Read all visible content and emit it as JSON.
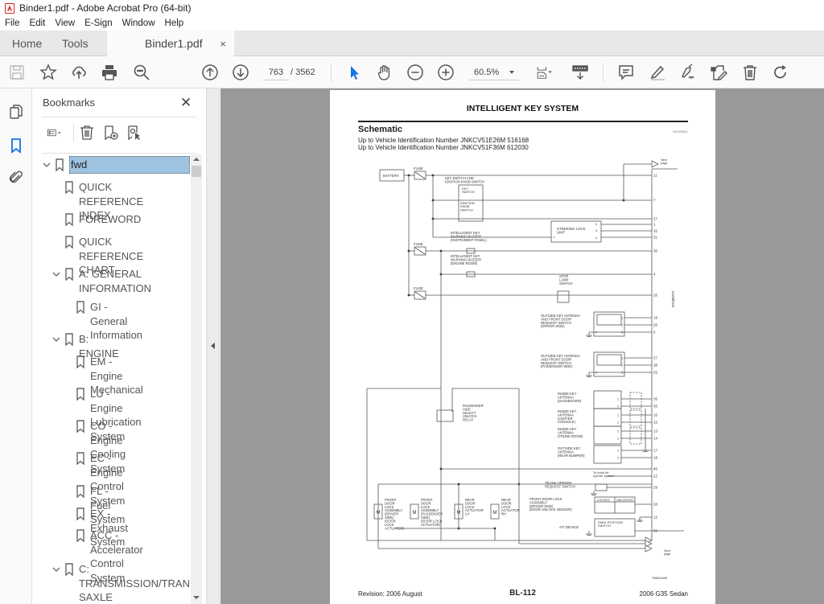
{
  "window": {
    "title": "Binder1.pdf - Adobe Acrobat Pro (64-bit)",
    "app_icon": "acrobat-icon"
  },
  "menu": [
    "File",
    "Edit",
    "View",
    "E-Sign",
    "Window",
    "Help"
  ],
  "tabs": {
    "home": "Home",
    "tools": "Tools",
    "document": "Binder1.pdf",
    "close": "×"
  },
  "toolbar": {
    "icons": [
      "save-icon",
      "bookmark-star-icon",
      "upload-cloud-icon",
      "print-icon",
      "find-icon",
      "previous-page-icon",
      "next-page-icon",
      "select-cursor-icon",
      "hand-tool-icon",
      "zoom-out-icon",
      "zoom-in-icon",
      "page-fit-icon",
      "scroll-mode-icon",
      "comment-icon",
      "highlight-icon",
      "sign-icon",
      "edit-pdf-icon",
      "delete-icon",
      "rotate-icon"
    ],
    "current_page": "763",
    "page_separator": "/ 3562",
    "total_pages": "3562",
    "zoom_level": "60.5%"
  },
  "rail": {
    "icons": [
      "page-thumbnails-icon",
      "bookmarks-icon",
      "attachments-icon"
    ],
    "active": "bookmarks-icon",
    "active_color": "#1473e6"
  },
  "bookmarks": {
    "title": "Bookmarks",
    "close": "✕",
    "tools": [
      "options-menu-icon",
      "delete-bookmark-icon",
      "new-bookmark-icon",
      "find-current-bookmark-icon"
    ],
    "items": [
      {
        "label": "fwd",
        "level": 0,
        "expanded": true,
        "selected": true
      },
      {
        "label": "QUICK REFERENCE\nINDEX",
        "level": 1
      },
      {
        "label": "FOREWORD",
        "level": 1
      },
      {
        "label": "QUICK REFERENCE\nCHART",
        "level": 1
      },
      {
        "label": "A: GENERAL\nINFORMATION",
        "level": 1,
        "expanded": true
      },
      {
        "label": "GI - General\nInformation",
        "level": 2
      },
      {
        "label": "B: ENGINE",
        "level": 1,
        "expanded": true
      },
      {
        "label": "EM - Engine\nMechanical",
        "level": 2
      },
      {
        "label": "LU - Engine\nLubrication System",
        "level": 2
      },
      {
        "label": "CO - Engine Cooling\nSystem",
        "level": 2
      },
      {
        "label": "EC - Engine Control\nSystem",
        "level": 2
      },
      {
        "label": "FL - Fuel System",
        "level": 2
      },
      {
        "label": "EX - Exhaust System",
        "level": 2
      },
      {
        "label": "ACC - Accelerator\nControl System",
        "level": 2
      },
      {
        "label": "C:\nTRANSMISSION/TRAN\nSAXLE",
        "level": 1,
        "expanded": true
      }
    ],
    "selected_color": "#9ec3e0"
  },
  "page": {
    "title": "INTELLIGENT KEY SYSTEM",
    "section": "Schematic",
    "section_code": "NIS00B04",
    "vin_lines": [
      "Up to Vehicle Identification Number JNKCV51E26M 516168",
      "Up to Vehicle Identification Number JNKCV51F36M 612030"
    ],
    "footer_left": "Revision: 2006 August",
    "footer_center": "BL-112",
    "footer_right": "2006 G35 Sedan",
    "figure_code": "TIWM1046E",
    "diagram": {
      "unit_label": "INTELLIGENT KEY UNIT",
      "labels": {
        "battery": "BATTERY",
        "fuse": "FUSE",
        "key_switch_group": "KEY SWITCH AND\nIGNITION KNOB SWITCH",
        "key_switch": "KEY\nSWITCH",
        "ignition_knob": "IGNITION\nKNOB\nSWITCH",
        "steering_lock": "STEERING LOCK\nUNIT",
        "buzzer_ip": "INTELLIGENT KEY\nWARNING BUZZER\n(INSTRUMENT PANEL)",
        "buzzer_er": "INTELLIGENT KEY\nWARNING BUZZER\n(ENGINE ROOM)",
        "stop_lamp": "STOP\nLAMP\nSWITCH",
        "outside_driver": "OUTSIDE KEY ANTENNA\nAND FRONT DOOR\nREQUEST SWITCH\n(DRIVER SIDE)",
        "outside_passenger": "OUTSIDE KEY ANTENNA\nAND FRONT DOOR\nREQUEST SWITCH\n(PASSENGER SIDE)",
        "inside_dash": "INSIDE KEY\nANTENNA\n(DASHBOARD)",
        "inside_console": "INSIDE KEY\nANTENNA\n(CENTER\nCONSOLE)",
        "inside_trunk": "INSIDE KEY\nANTENNA\n(TRUNK ROOM)",
        "outside_rear": "OUTSIDE KEY\nANTENNA\n(REAR BUMPER)",
        "relay": "PASSENGER\nSIDE\nSELECT\nUNLOCK\nRELAY",
        "trunk_lid": "To trunk lid\nopener system",
        "trunk_opener": "TRUNK OPENER\nREQUEST SWITCH",
        "front_door_sensor": "FRONT DOOR LOCK\nASSEMBLY\n(DRIVER SIDE)\n(DOOR UNLOCK SENSOR)",
        "locked": "LOCKED",
        "unlocked": "UNLOCKED",
        "park_position": "PARK POSITION\nSWITCH",
        "at_device": "A/T DEVICE",
        "fdl_driver": "FRONT\nDOOR\nLOCK\nASSEMBLY\n(DRIVER\nSIDE)\n(DOOR\nLOCK\nACTUATOR)",
        "fdl_passenger": "FRONT\nDOOR\nLOCK\nASSEMBLY\n(PASSENGER\nSIDE)\n(DOOR LOCK\nACTUATOR)",
        "rear_lh": "REAR\nDOOR\nLOCK\nACTUATOR\nLH",
        "rear_rh": "REAR\nDOOR\nLOCK\nACTUATOR\nRH",
        "next_page": "Next\npage",
        "motor": "M"
      },
      "terminals": [
        "11",
        "7",
        "27",
        "1",
        "32",
        "31",
        "30",
        "4",
        "26",
        "19",
        "20",
        "5",
        "37",
        "38",
        "25",
        "35",
        "36",
        "15",
        "16",
        "13",
        "14",
        "17",
        "18",
        "40",
        "22",
        "29",
        "28",
        "12",
        "39"
      ],
      "steering_pins": [
        "1",
        "2",
        "3",
        "4"
      ]
    }
  }
}
